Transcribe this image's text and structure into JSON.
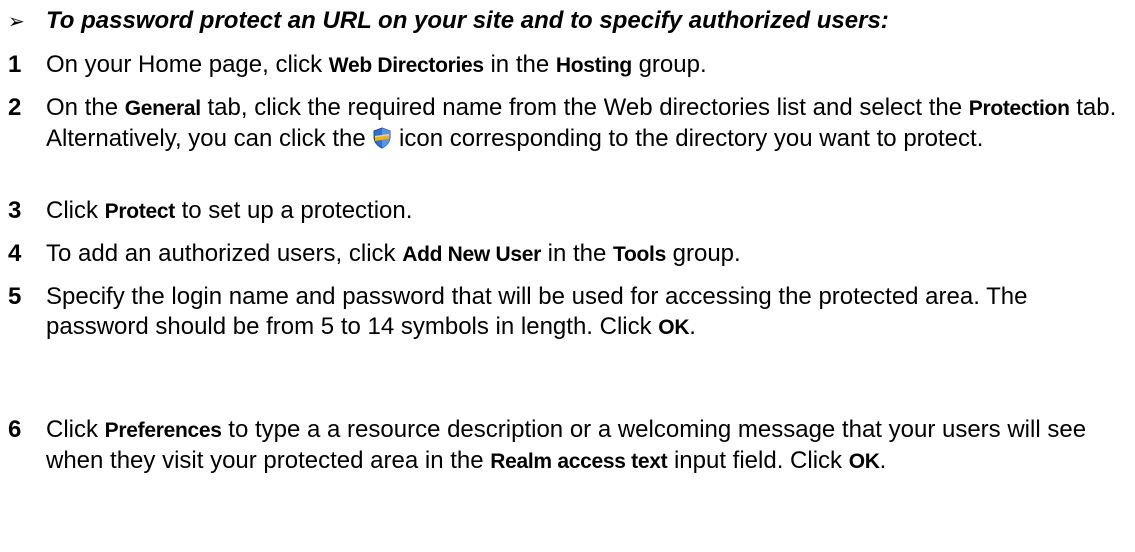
{
  "heading": {
    "bullet": "➢",
    "text": "To password protect an URL on your site and to specify authorized users:"
  },
  "steps": [
    {
      "num": "1",
      "t1": "On your Home page, click ",
      "b1": "Web Directories",
      "t2": " in the ",
      "b2": "Hosting",
      "t3": " group."
    },
    {
      "num": "2",
      "t1": "On the ",
      "b1": "General",
      "t2": " tab, click the required name from the Web directories list and select the ",
      "b2": "Protection",
      "t3": " tab. Alternatively, you can click the ",
      "icon": "shield-icon",
      "t4": " icon corresponding to the directory you want to protect."
    },
    {
      "num": "3",
      "t1": "Click ",
      "b1": "Protect",
      "t2": " to set up a protection."
    },
    {
      "num": "4",
      "t1": "To add an authorized users, click ",
      "b1": "Add New User",
      "t2": " in the ",
      "b2": "Tools",
      "t3": " group."
    },
    {
      "num": "5",
      "t1": "Specify the login name and password that will be used for accessing the protected area. The password should be from 5 to 14 symbols in length. Click ",
      "b1": "OK",
      "t2": "."
    },
    {
      "num": "6",
      "t1": "Click ",
      "b1": "Preferences",
      "t2": " to type a a resource description or a welcoming message that your users will see when they visit your protected area in the ",
      "b2": "Realm access text",
      "t3": " input field. Click ",
      "b3": "OK",
      "t4": "."
    }
  ],
  "colors": {
    "text": "#000000",
    "shield_blue": "#2f6fd0",
    "shield_gold": "#e8b020"
  }
}
